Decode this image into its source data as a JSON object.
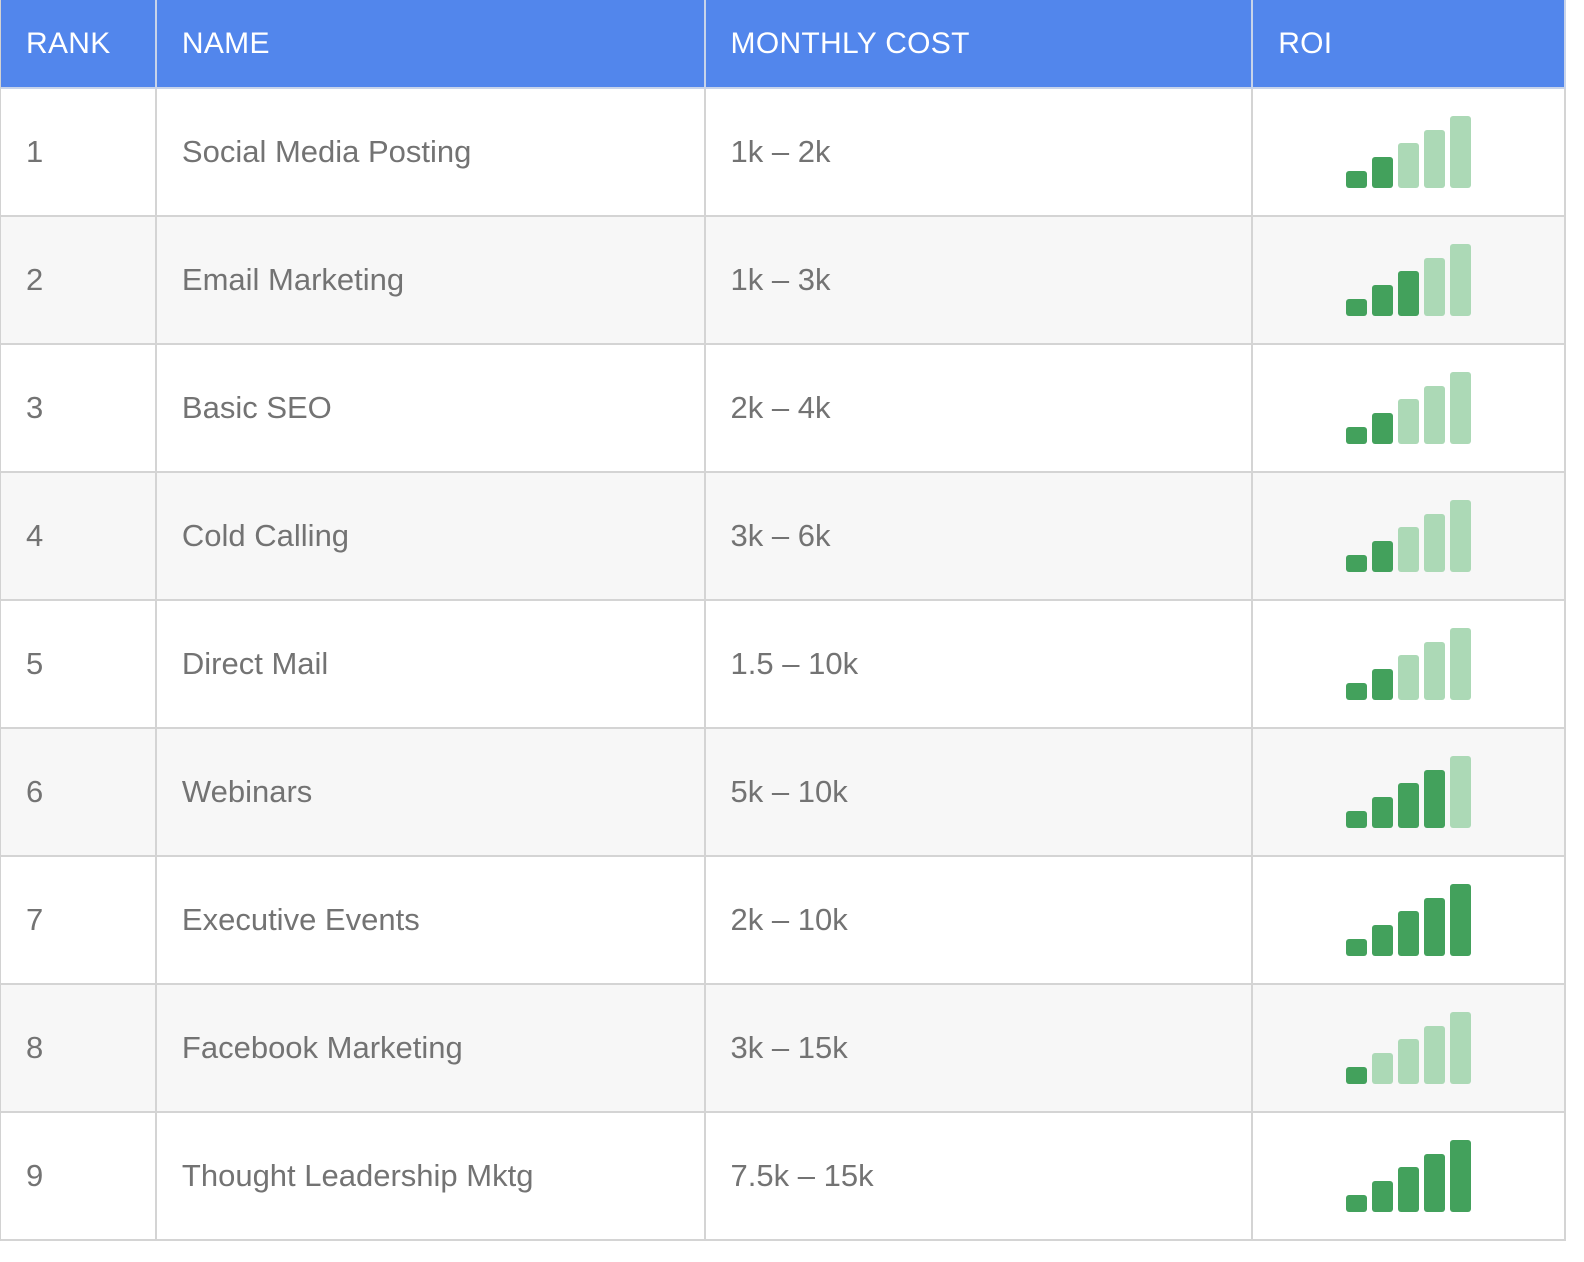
{
  "table": {
    "headers": [
      "RANK",
      "NAME",
      "MONTHLY COST",
      "ROI"
    ],
    "rows": [
      {
        "rank": "1",
        "name": "Social Media Posting",
        "cost": "1k – 2k",
        "roi_level": 2,
        "roi_max": 5
      },
      {
        "rank": "2",
        "name": "Email Marketing",
        "cost": "1k – 3k",
        "roi_level": 3,
        "roi_max": 5
      },
      {
        "rank": "3",
        "name": "Basic SEO",
        "cost": "2k – 4k",
        "roi_level": 2,
        "roi_max": 5
      },
      {
        "rank": "4",
        "name": "Cold Calling",
        "cost": "3k – 6k",
        "roi_level": 2,
        "roi_max": 5
      },
      {
        "rank": "5",
        "name": "Direct Mail",
        "cost": "1.5 – 10k",
        "roi_level": 2,
        "roi_max": 5
      },
      {
        "rank": "6",
        "name": "Webinars",
        "cost": "5k – 10k",
        "roi_level": 4,
        "roi_max": 5
      },
      {
        "rank": "7",
        "name": "Executive Events",
        "cost": "2k – 10k",
        "roi_level": 5,
        "roi_max": 5
      },
      {
        "rank": "8",
        "name": "Facebook Marketing",
        "cost": "3k – 15k",
        "roi_level": 1,
        "roi_max": 5
      },
      {
        "rank": "9",
        "name": "Thought Leadership Mktg",
        "cost": "7.5k – 15k",
        "roi_level": 5,
        "roi_max": 5
      }
    ]
  },
  "colors": {
    "header_bg": "#5286ec",
    "bar_active": "#43a15c",
    "bar_inactive": "#acd9b6",
    "stripe": "#f7f7f7"
  }
}
